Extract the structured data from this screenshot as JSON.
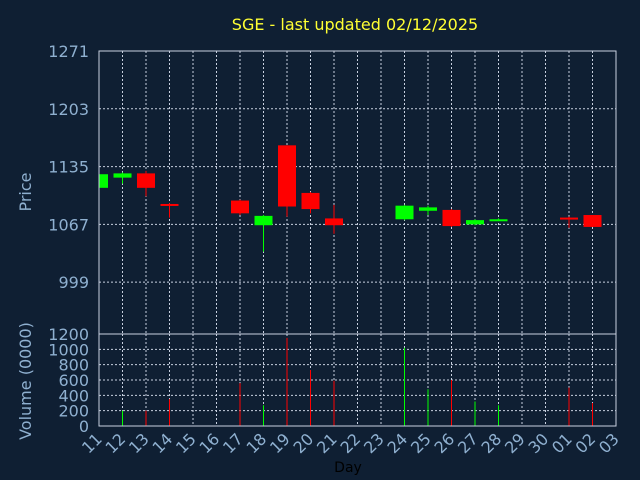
{
  "chart_data": {
    "type": "candlestick",
    "title": "SGE - last updated 02/12/2025",
    "xlabel": "Day",
    "ylabel_price": "Price",
    "ylabel_volume": "Volume (0000)",
    "colors": {
      "background": "#0f1f33",
      "up": "#00ff00",
      "down": "#ff0000",
      "text": "#8fb0d0",
      "title": "#ffff33",
      "grid": "#c8d0e0"
    },
    "grid": true,
    "x_tick_labels": [
      "11",
      "12",
      "13",
      "14",
      "15",
      "16",
      "17",
      "18",
      "19",
      "20",
      "21",
      "22",
      "23",
      "24",
      "25",
      "26",
      "27",
      "28",
      "29",
      "30",
      "01",
      "02",
      "03"
    ],
    "price_ticks": [
      "1271",
      "1203",
      "1135",
      "1067",
      "999"
    ],
    "price_ylim": [
      938,
      1271
    ],
    "volume_ticks": [
      "1200",
      "1000",
      "800",
      "600",
      "400",
      "200",
      "0"
    ],
    "volume_ylim": [
      0,
      1200
    ],
    "candles": [
      {
        "day": "11",
        "open": 1110,
        "close": 1126,
        "high": 1126,
        "low": 1110,
        "volume": 0
      },
      {
        "day": "12",
        "open": 1122,
        "close": 1127,
        "high": 1128,
        "low": 1115,
        "volume": 200
      },
      {
        "day": "13",
        "open": 1127,
        "close": 1110,
        "high": 1130,
        "low": 1100,
        "volume": 200
      },
      {
        "day": "14",
        "open": 1091,
        "close": 1089,
        "high": 1092,
        "low": 1075,
        "volume": 350
      },
      {
        "day": "17",
        "open": 1095,
        "close": 1080,
        "high": 1096,
        "low": 1078,
        "volume": 560
      },
      {
        "day": "18",
        "open": 1066,
        "close": 1077,
        "high": 1078,
        "low": 1035,
        "volume": 270
      },
      {
        "day": "19",
        "open": 1160,
        "close": 1088,
        "high": 1160,
        "low": 1076,
        "volume": 1150
      },
      {
        "day": "20",
        "open": 1104,
        "close": 1085,
        "high": 1105,
        "low": 1080,
        "volume": 730
      },
      {
        "day": "21",
        "open": 1074,
        "close": 1066,
        "high": 1090,
        "low": 1056,
        "volume": 590
      },
      {
        "day": "24",
        "open": 1073,
        "close": 1089,
        "high": 1090,
        "low": 1072,
        "volume": 1020
      },
      {
        "day": "25",
        "open": 1083,
        "close": 1087,
        "high": 1089,
        "low": 1078,
        "volume": 480
      },
      {
        "day": "26",
        "open": 1084,
        "close": 1065,
        "high": 1085,
        "low": 1064,
        "volume": 600
      },
      {
        "day": "27",
        "open": 1067,
        "close": 1072,
        "high": 1073,
        "low": 1066,
        "volume": 320
      },
      {
        "day": "28",
        "open": 1072,
        "close": 1073,
        "high": 1074,
        "low": 1071,
        "volume": 270
      },
      {
        "day": "01",
        "open": 1075,
        "close": 1074,
        "high": 1076,
        "low": 1063,
        "volume": 500
      },
      {
        "day": "02",
        "open": 1078,
        "close": 1064,
        "high": 1078,
        "low": 1064,
        "volume": 300
      }
    ]
  }
}
